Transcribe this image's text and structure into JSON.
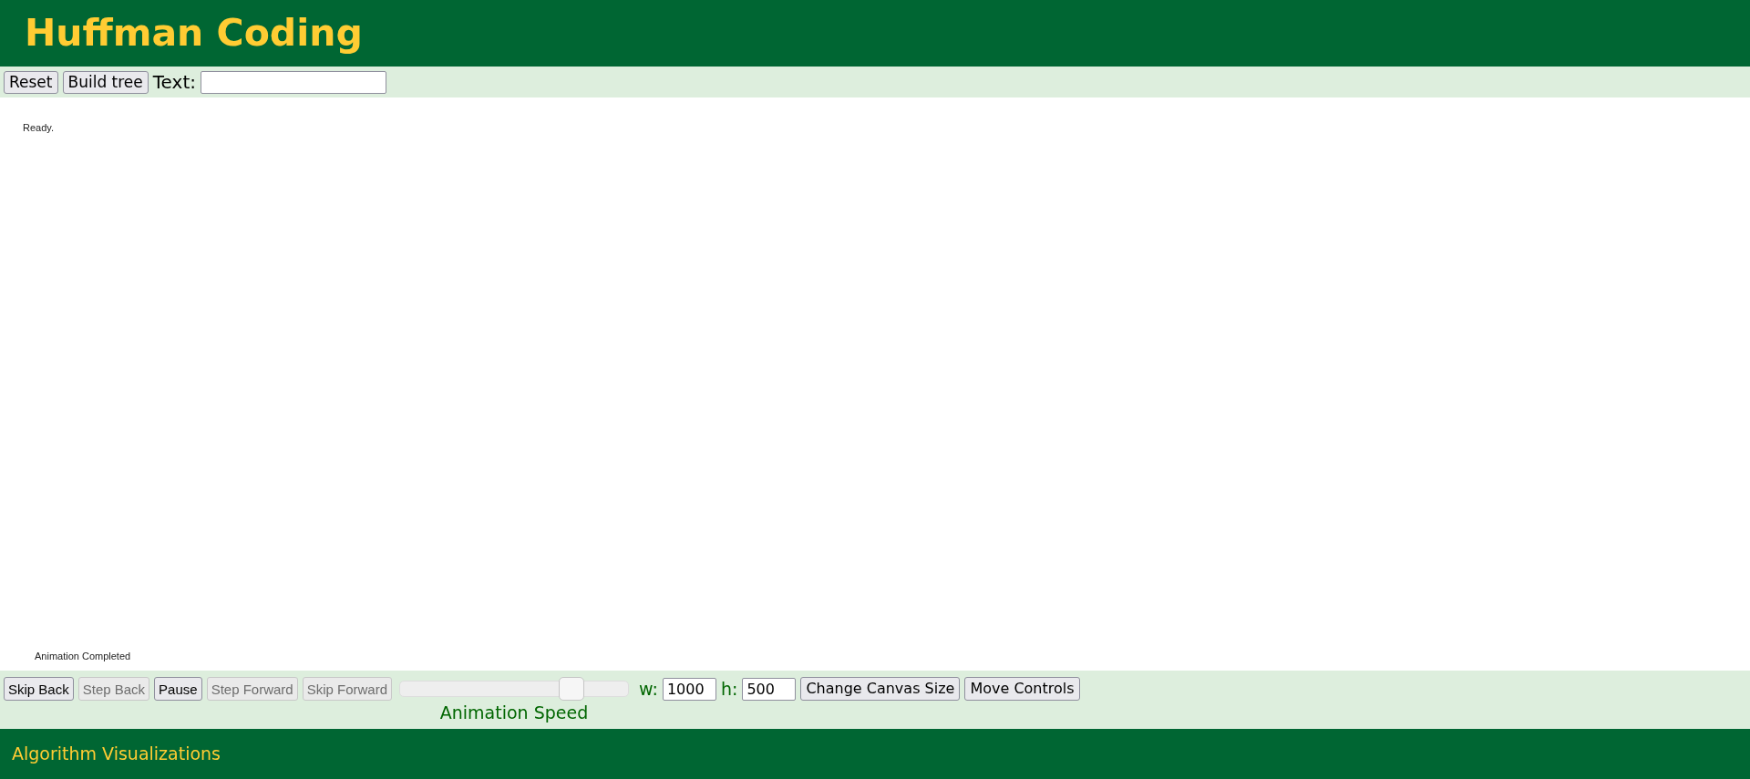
{
  "header": {
    "title": "Huffman Coding"
  },
  "toolbar": {
    "buttons": [
      {
        "label": "Reset",
        "disabled": false
      },
      {
        "label": "Build tree",
        "disabled": false
      }
    ],
    "text_label": "Text:"
  },
  "canvas": {
    "status": "Ready.",
    "message": "Animation Completed"
  },
  "controls": {
    "buttons": [
      {
        "label": "Skip Back",
        "disabled": false
      },
      {
        "label": "Step Back",
        "disabled": true
      },
      {
        "label": "Pause",
        "disabled": false
      },
      {
        "label": "Step Forward",
        "disabled": true
      },
      {
        "label": "Skip Forward",
        "disabled": true
      }
    ],
    "speed": {
      "label": "Animation Speed",
      "level": 0.75
    },
    "width_label": "w:",
    "width_value": "1000",
    "height_label": "h:",
    "height_value": "500",
    "actions": [
      {
        "label": "Change Canvas Size",
        "disabled": false
      },
      {
        "label": "Move Controls",
        "disabled": false
      }
    ]
  },
  "footer": {
    "text": "Algorithm Visualizations"
  }
}
